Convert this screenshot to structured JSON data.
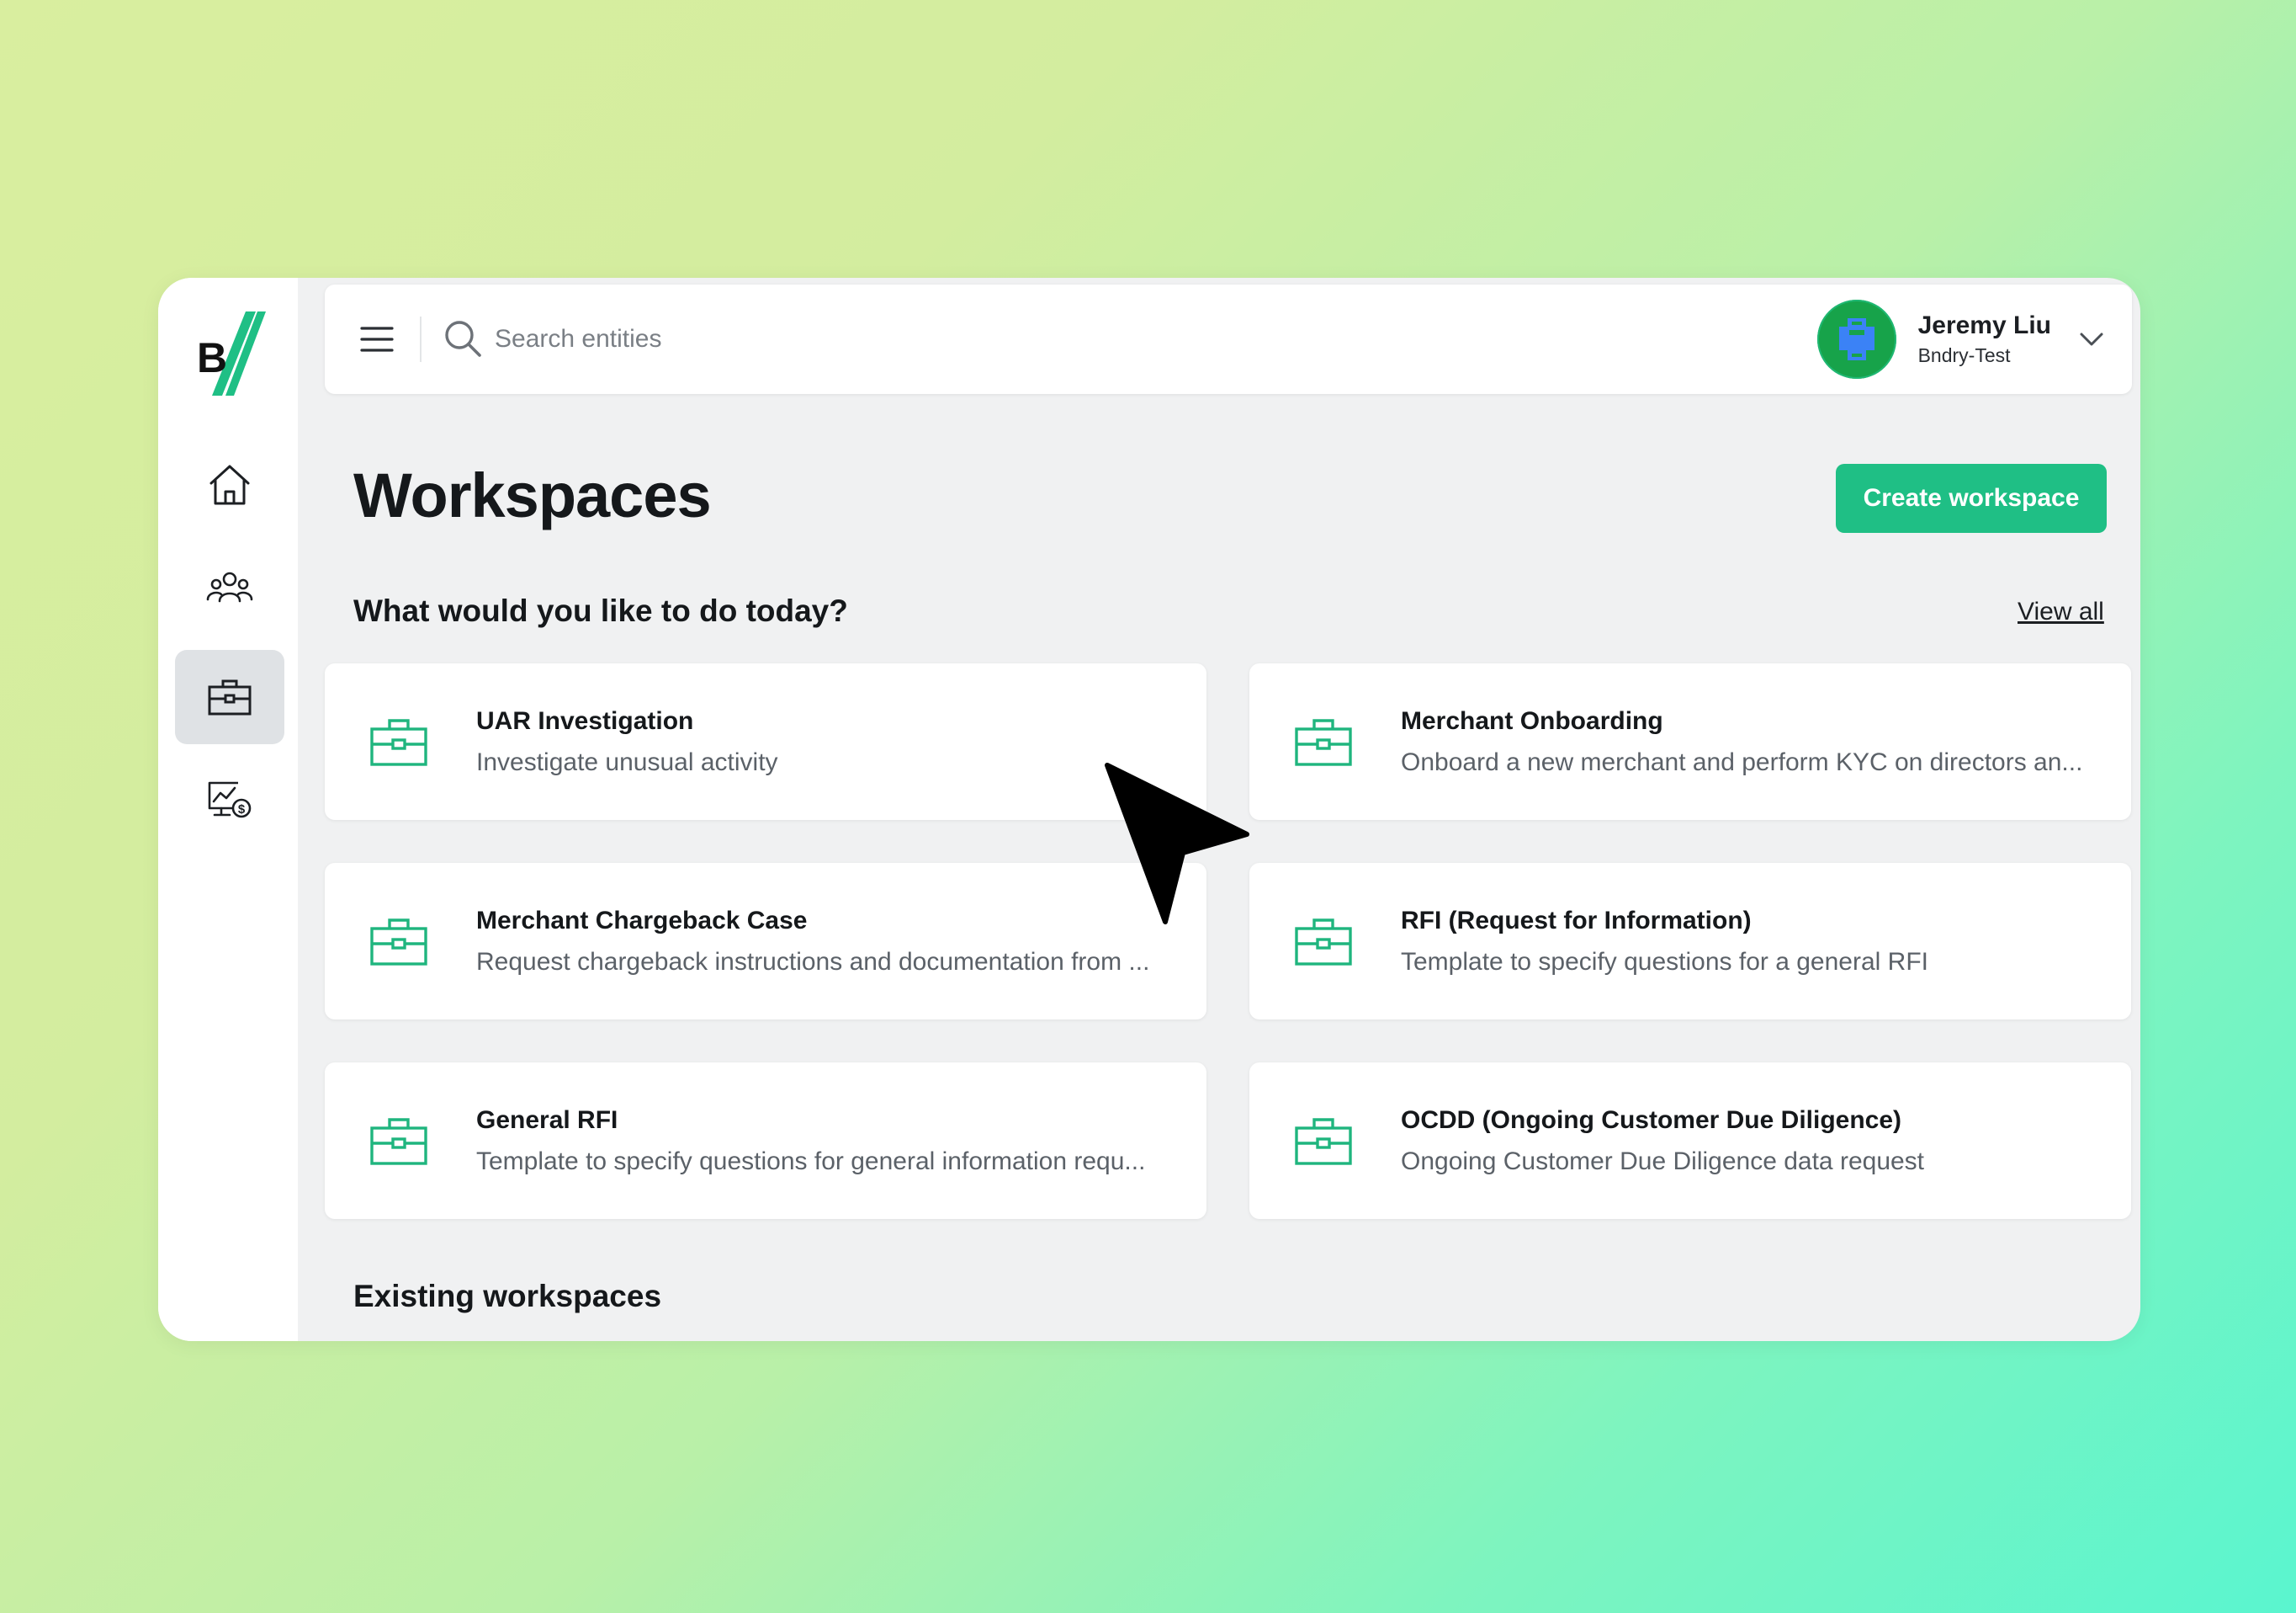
{
  "colors": {
    "accent": "#1fbf85",
    "icon_green": "#1fb57e",
    "page_background": "#f0f1f2"
  },
  "sidebar": {
    "logo_text": "B",
    "items": [
      {
        "name": "home",
        "icon": "home-icon",
        "active": false
      },
      {
        "name": "entities",
        "icon": "people-icon",
        "active": false
      },
      {
        "name": "workspaces",
        "icon": "briefcase-icon",
        "active": true
      },
      {
        "name": "monitoring",
        "icon": "chart-dollar-icon",
        "active": false
      }
    ]
  },
  "topbar": {
    "menu_icon": "hamburger-icon",
    "search_icon": "search-icon",
    "search_placeholder": "Search entities",
    "user": {
      "name": "Jeremy Liu",
      "org": "Bndry-Test",
      "chevron_icon": "chevron-down-icon"
    }
  },
  "main": {
    "title": "Workspaces",
    "create_button": "Create workspace",
    "section_title": "What would you like to do today?",
    "view_all": "View all",
    "templates": [
      {
        "title": "UAR Investigation",
        "description": "Investigate unusual activity"
      },
      {
        "title": "Merchant Onboarding",
        "description": "Onboard a new merchant and perform KYC on directors an..."
      },
      {
        "title": "Merchant Chargeback Case",
        "description": "Request chargeback instructions and documentation from ..."
      },
      {
        "title": "RFI (Request for Information)",
        "description": "Template to specify questions for a general RFI"
      },
      {
        "title": "General RFI",
        "description": "Template to specify questions for general information requ..."
      },
      {
        "title": "OCDD (Ongoing Customer Due Diligence)",
        "description": "Ongoing Customer Due Diligence data request"
      }
    ],
    "existing_title": "Existing workspaces"
  }
}
